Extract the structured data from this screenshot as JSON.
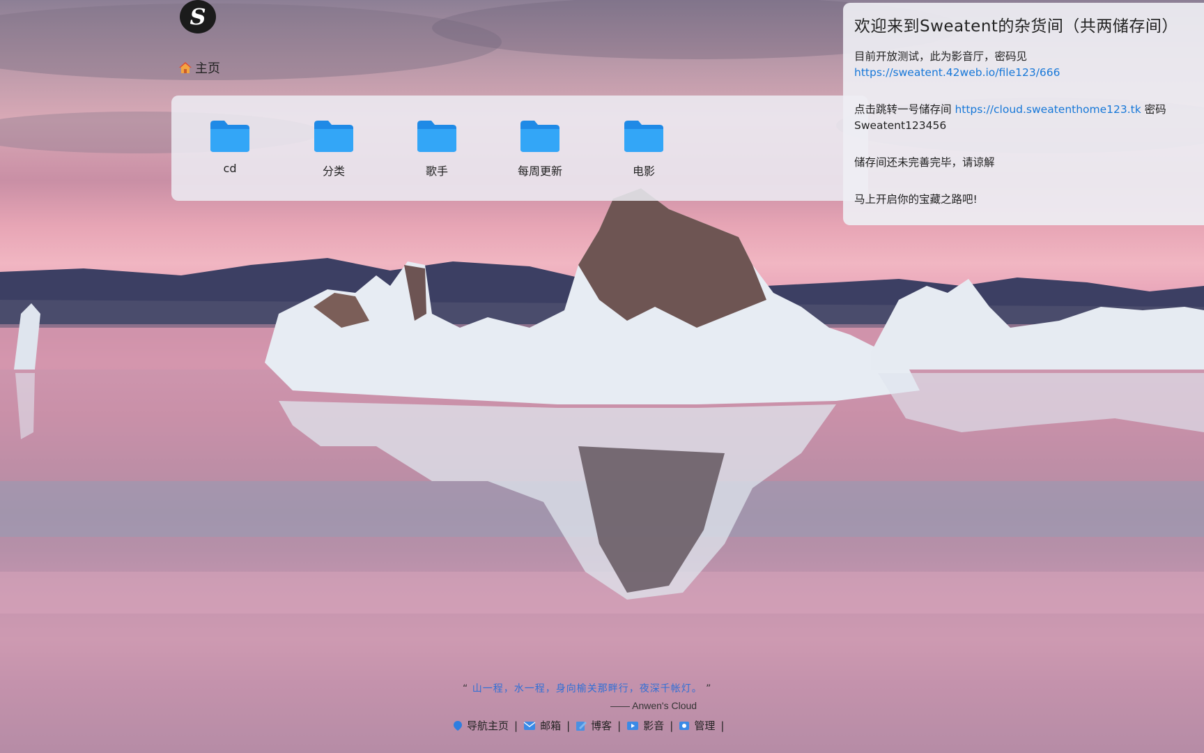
{
  "header": {
    "logo_letter": "S",
    "breadcrumb": "主页"
  },
  "folders": [
    {
      "label": "cd"
    },
    {
      "label": "分类"
    },
    {
      "label": "歌手"
    },
    {
      "label": "每周更新"
    },
    {
      "label": "电影"
    }
  ],
  "notice": {
    "title": "欢迎来到Sweatent的杂货间（共两储存间）",
    "line1_text": "目前开放测试，此为影音厅，密码见",
    "line1_link": "https://sweatent.42web.io/file123/666",
    "line2_text": "点击跳转一号储存间",
    "line2_link": "https://cloud.sweatenthome123.tk",
    "line2_suffix": "密码",
    "line2_password": "Sweatent123456",
    "line3": "储存间还未完善完毕，请谅解",
    "line4": "马上开启你的宝藏之路吧!"
  },
  "footer": {
    "quote_open": "“",
    "quote": "山一程，水一程，身向榆关那畔行，夜深千帐灯。",
    "quote_close": "”",
    "signature": "—— Anwen's Cloud",
    "links": [
      "导航主页",
      "邮箱",
      "博客",
      "影音",
      "管理"
    ],
    "separator": "|"
  },
  "colors": {
    "folder": "#2f9cf4",
    "link": "#1677d8",
    "quote": "#2f6fd6"
  },
  "icons": {
    "breadcrumb": "home-icon",
    "folder": "folder-icon",
    "footer": [
      "navigation-icon",
      "mail-icon",
      "blog-icon",
      "media-icon",
      "admin-icon"
    ]
  }
}
